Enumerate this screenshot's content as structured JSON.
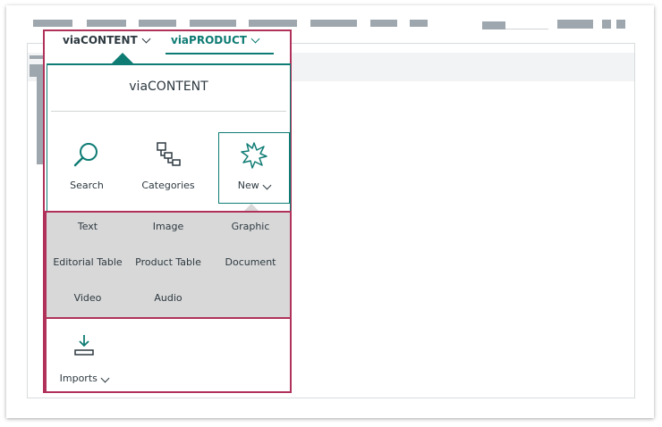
{
  "tabs": [
    {
      "label": "viaCONTENT"
    },
    {
      "label": "viaPRODUCT"
    }
  ],
  "dropdown": {
    "title": "viaCONTENT",
    "actions": {
      "search": "Search",
      "categories": "Categories",
      "new": "New"
    },
    "new_submenu": [
      "Text",
      "Image",
      "Graphic",
      "Editorial Table",
      "Product Table",
      "Document",
      "Video",
      "Audio"
    ],
    "imports": "Imports"
  },
  "colors": {
    "accent": "#0f7c74",
    "highlight": "#b0325a",
    "submenu_bg": "#d8d8d8",
    "placeholder": "#9ea7ad"
  }
}
